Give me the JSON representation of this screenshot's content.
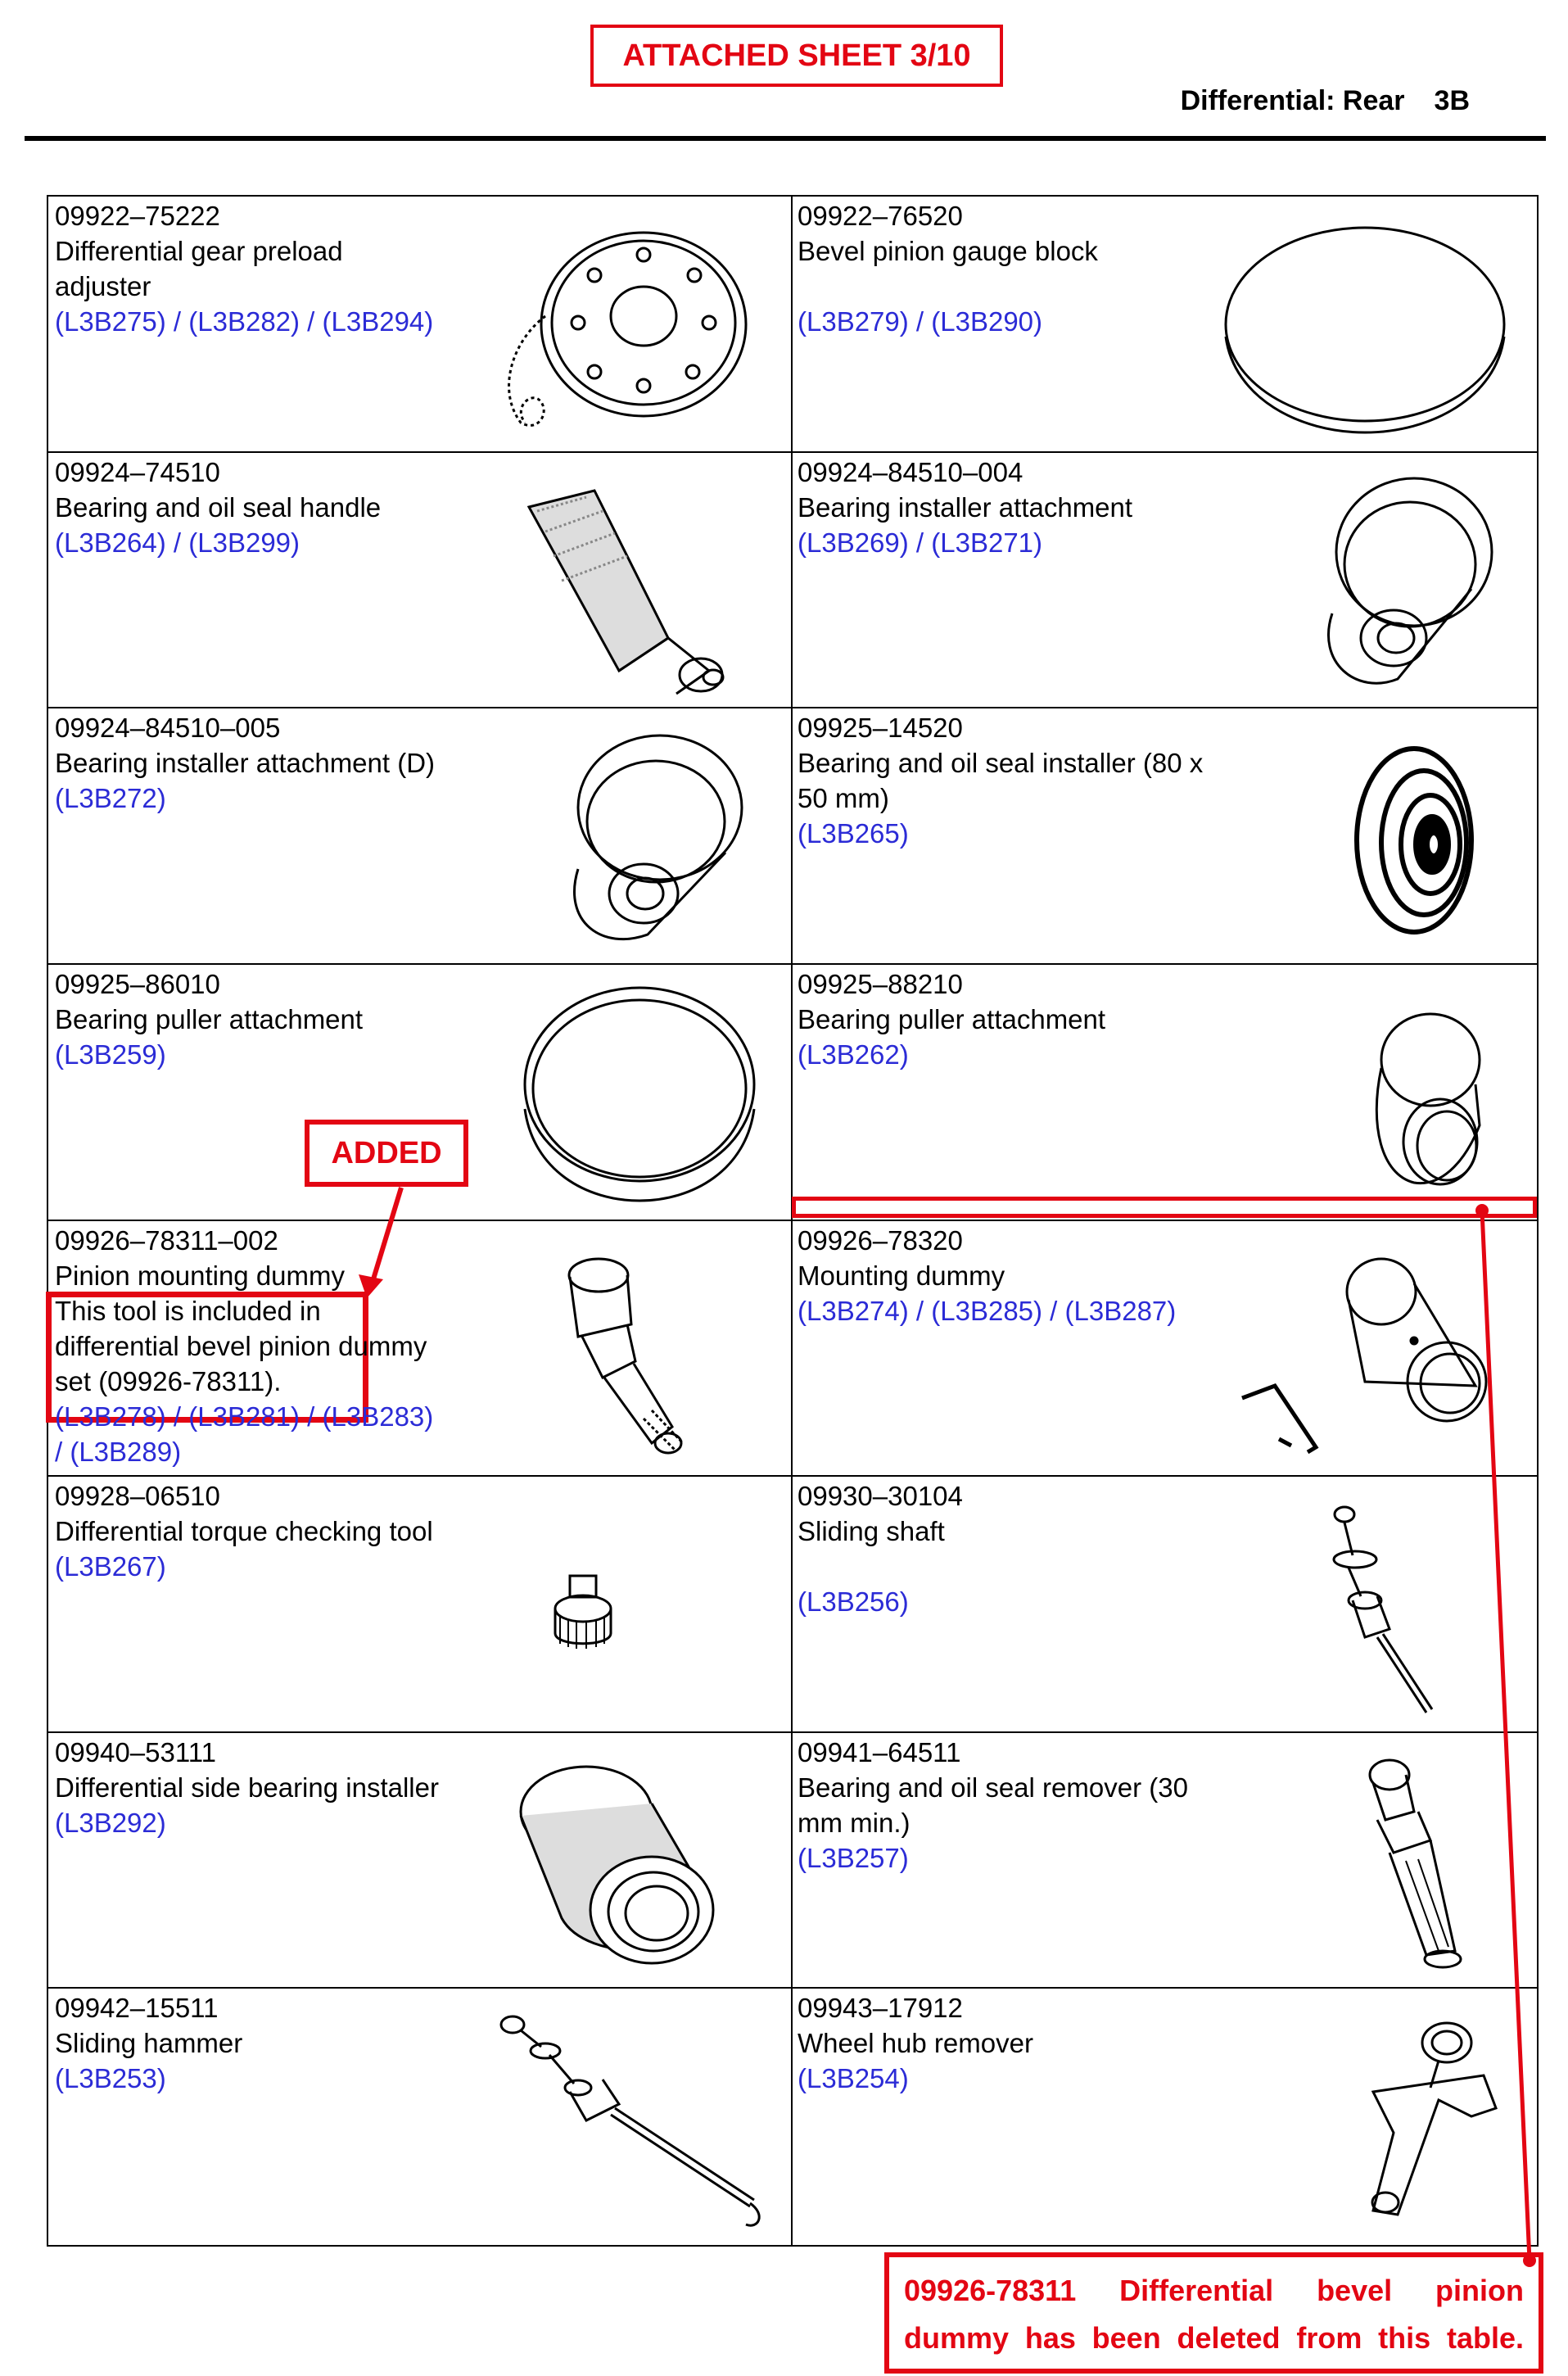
{
  "header": {
    "banner": "ATTACHED SHEET 3/10",
    "section_title": "Differential: Rear",
    "section_code": "3B"
  },
  "tools": [
    {
      "part_no": "09922–75222",
      "name": "Differential gear preload adjuster",
      "refs": "(L3B275) / (L3B282) / (L3B294)",
      "icon": "preload-adjuster-icon"
    },
    {
      "part_no": "09922–76520",
      "name": "Bevel pinion gauge block",
      "refs": "(L3B279) / (L3B290)",
      "icon": "gauge-block-icon"
    },
    {
      "part_no": "09924–74510",
      "name": "Bearing and oil seal handle",
      "refs": "(L3B264) / (L3B299)",
      "icon": "seal-handle-icon"
    },
    {
      "part_no": "09924–84510–004",
      "name": "Bearing installer attachment",
      "refs": "(L3B269) / (L3B271)",
      "icon": "installer-attachment-icon"
    },
    {
      "part_no": "09924–84510–005",
      "name": "Bearing installer attachment (D)",
      "refs": "(L3B272)",
      "icon": "installer-attachment-d-icon"
    },
    {
      "part_no": "09925–14520",
      "name": "Bearing and oil seal installer (80 x 50 mm)",
      "refs": "(L3B265)",
      "icon": "seal-installer-icon"
    },
    {
      "part_no": "09925–86010",
      "name": "Bearing puller attachment",
      "refs": "(L3B259)",
      "icon": "puller-attachment-icon"
    },
    {
      "part_no": "09925–88210",
      "name": "Bearing puller attachment",
      "refs": "(L3B262)",
      "icon": "small-puller-attachment-icon"
    },
    {
      "part_no": "09926–78311–002",
      "name": "Pinion mounting dummy",
      "note": "This tool is included in differential bevel pinion dummy set (09926-78311).",
      "refs": "(L3B278) / (L3B281) / (L3B283) / (L3B289)",
      "icon": "pinion-dummy-icon"
    },
    {
      "part_no": "09926–78320",
      "name": "Mounting dummy",
      "refs": "(L3B274) / (L3B285) / (L3B287)",
      "icon": "mounting-dummy-icon"
    },
    {
      "part_no": "09928–06510",
      "name": "Differential torque checking tool",
      "refs": "(L3B267)",
      "icon": "torque-tool-icon"
    },
    {
      "part_no": "09930–30104",
      "name": "Sliding shaft",
      "refs": "(L3B256)",
      "icon": "sliding-shaft-icon"
    },
    {
      "part_no": "09940–53111",
      "name": "Differential side bearing installer",
      "refs": "(L3B292)",
      "icon": "side-bearing-installer-icon"
    },
    {
      "part_no": "09941–64511",
      "name": "Bearing and oil seal remover (30 mm min.)",
      "refs": "(L3B257)",
      "icon": "seal-remover-icon"
    },
    {
      "part_no": "09942–15511",
      "name": "Sliding hammer",
      "refs": "(L3B253)",
      "icon": "sliding-hammer-icon"
    },
    {
      "part_no": "09943–17912",
      "name": "Wheel hub remover",
      "refs": "(L3B254)",
      "icon": "hub-remover-icon"
    }
  ],
  "annotations": {
    "added_label": "ADDED",
    "deleted_note": "09926-78311 Differential bevel pinion dummy has been deleted from this table.",
    "color": "#e30613"
  },
  "colors": {
    "reference_link": "#2b2bd6"
  }
}
